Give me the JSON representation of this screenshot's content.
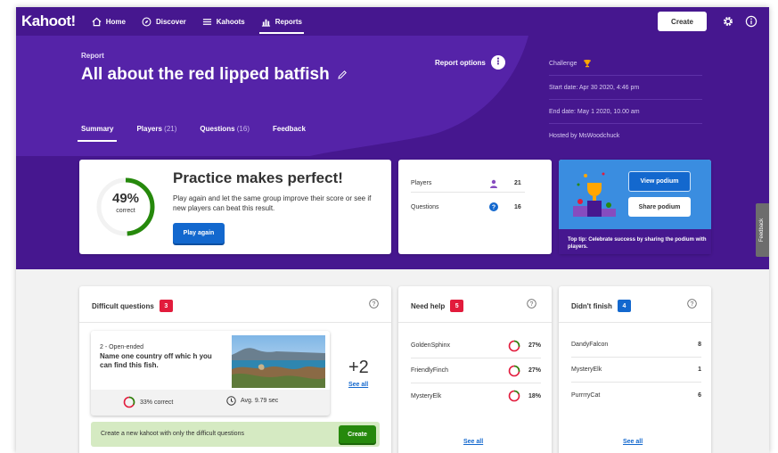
{
  "nav": {
    "logo": "Kahoot!",
    "items": [
      {
        "label": "Home",
        "icon": "home-icon"
      },
      {
        "label": "Discover",
        "icon": "compass-icon"
      },
      {
        "label": "Kahoots",
        "icon": "list-icon"
      },
      {
        "label": "Reports",
        "icon": "bar-chart-icon"
      }
    ],
    "active": "Reports",
    "create_label": "Create"
  },
  "report": {
    "label": "Report",
    "title": "All about the red lipped batfish",
    "options_label": "Report options",
    "tabs": [
      {
        "label": "Summary",
        "count": ""
      },
      {
        "label": "Players",
        "count": "(21)"
      },
      {
        "label": "Questions",
        "count": "(16)"
      },
      {
        "label": "Feedback",
        "count": ""
      }
    ],
    "active_tab": "Summary",
    "info": {
      "challenge": "Challenge",
      "start": "Start date: Apr 30 2020, 4:46 pm",
      "end": "End date: May 1 2020, 10.00 am",
      "host": "Hosted by MsWoodchuck"
    }
  },
  "summary": {
    "percent": "49%",
    "percent_label": "correct",
    "percent_value": 49,
    "title": "Practice makes perfect!",
    "text": "Play again and let the same group improve their score or see if new players can beat this result.",
    "play_again": "Play again"
  },
  "stats": [
    {
      "label": "Players",
      "value": "21",
      "icon": "person-icon"
    },
    {
      "label": "Questions",
      "value": "16",
      "icon": "question-icon"
    }
  ],
  "podium": {
    "view": "View podium",
    "share": "Share podium",
    "tip": "Top tip: Celebrate success by sharing the podium with players."
  },
  "feedback_tab": "Feedback",
  "difficult": {
    "title": "Difficult questions",
    "count": "3",
    "question_type": "2 - Open-ended",
    "question_text": "Name one country off whic h you can find this fish.",
    "correct": "33% correct",
    "correct_value": 33,
    "avg": "Avg. 9.79 sec",
    "more": "+2",
    "see_all": "See all",
    "create_text": "Create a new kahoot with only the difficult questions",
    "create_button": "Create"
  },
  "need_help": {
    "title": "Need help",
    "count": "5",
    "rows": [
      {
        "name": "GoldenSphinx",
        "value": "27%",
        "pct": 27
      },
      {
        "name": "FriendlyFinch",
        "value": "27%",
        "pct": 27
      },
      {
        "name": "MysteryElk",
        "value": "18%",
        "pct": 18
      }
    ],
    "see_all": "See all"
  },
  "didnt_finish": {
    "title": "Didn't finish",
    "count": "4",
    "rows": [
      {
        "name": "DandyFalcon",
        "value": "8"
      },
      {
        "name": "MysteryElk",
        "value": "1"
      },
      {
        "name": "PurrrryCat",
        "value": "6"
      }
    ],
    "see_all": "See all"
  },
  "colors": {
    "purple": "#46178f",
    "blue": "#1368ce",
    "green": "#26890c",
    "red": "#e21b3c",
    "badge_blue": "#1368ce"
  }
}
